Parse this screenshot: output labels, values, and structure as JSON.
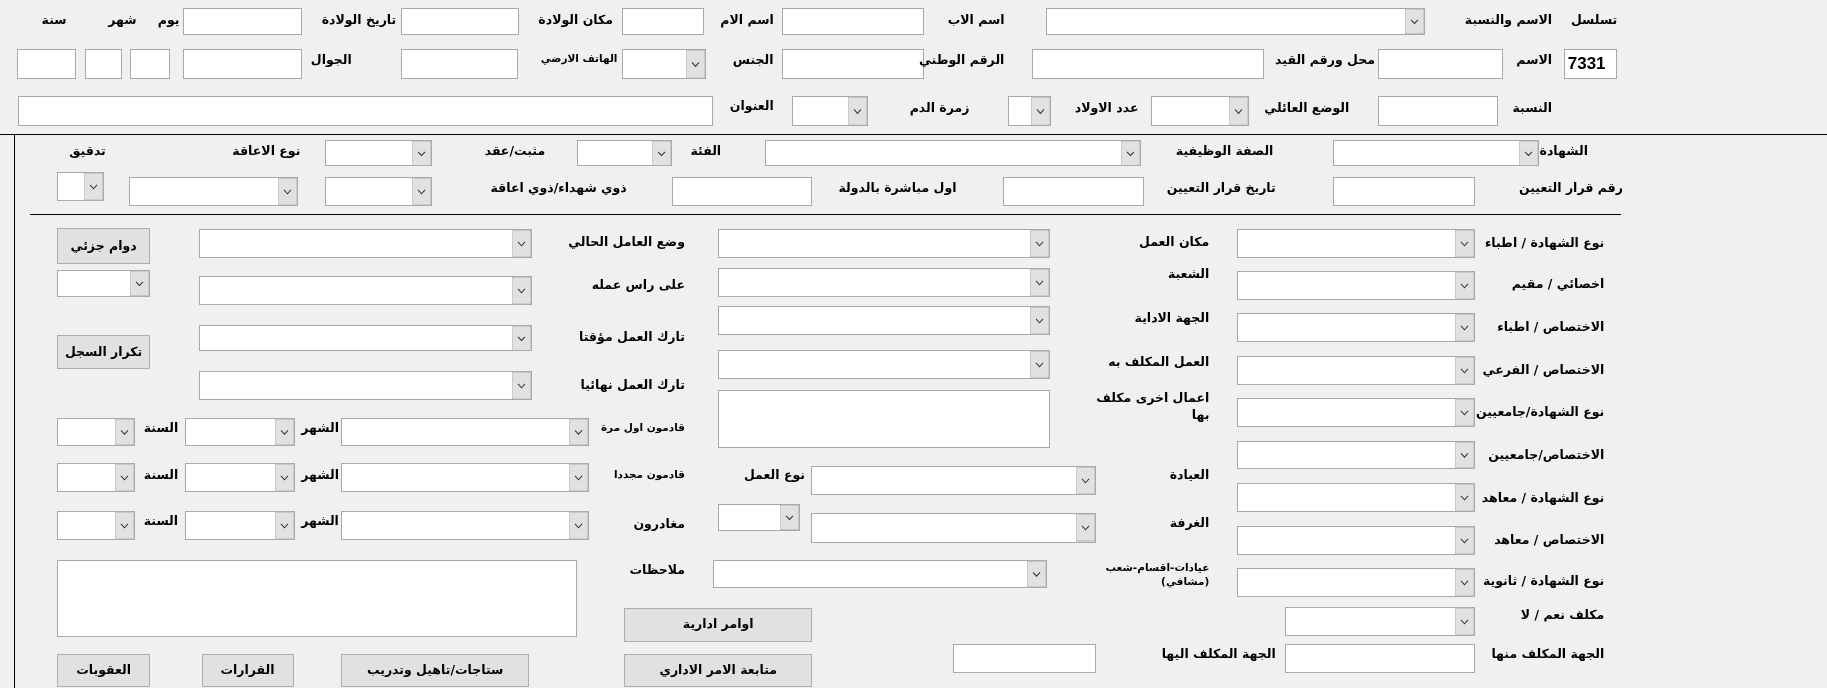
{
  "header": {
    "items": [
      {
        "kind": "label",
        "text": "تسلسل"
      },
      {
        "kind": "label",
        "text": "الاسم والنسبة"
      },
      {
        "kind": "combo"
      },
      {
        "kind": "label",
        "text": "اسم الاب"
      },
      {
        "kind": "text"
      },
      {
        "kind": "label",
        "text": "اسم الام"
      },
      {
        "kind": "text"
      },
      {
        "kind": "label",
        "text": "مكان الولادة"
      },
      {
        "kind": "text"
      },
      {
        "kind": "label",
        "text": "تاريخ الولادة"
      },
      {
        "kind": "text"
      },
      {
        "kind": "label",
        "text": "يوم"
      },
      {
        "kind": "label",
        "text": "شهر"
      },
      {
        "kind": "label",
        "text": "سنة"
      },
      {
        "kind": "text",
        "value": "7331"
      },
      {
        "kind": "label",
        "text": "الاسم"
      },
      {
        "kind": "text"
      },
      {
        "kind": "label",
        "text": "محل ورقم القيد"
      },
      {
        "kind": "text"
      },
      {
        "kind": "label",
        "text": "الرقم الوطني"
      },
      {
        "kind": "text"
      },
      {
        "kind": "label",
        "text": "الجنس"
      },
      {
        "kind": "combo"
      },
      {
        "kind": "label",
        "text": "الهاتف الارضي"
      },
      {
        "kind": "text"
      },
      {
        "kind": "label",
        "text": "الجوال"
      },
      {
        "kind": "text"
      },
      {
        "kind": "text"
      },
      {
        "kind": "text"
      },
      {
        "kind": "text"
      },
      {
        "kind": "label",
        "text": "النسبة"
      },
      {
        "kind": "text"
      },
      {
        "kind": "label",
        "text": "الوضع العائلي"
      },
      {
        "kind": "combo"
      },
      {
        "kind": "label",
        "text": "عدد الاولاد"
      },
      {
        "kind": "combo"
      },
      {
        "kind": "label",
        "text": "زمرة الدم"
      },
      {
        "kind": "combo"
      },
      {
        "kind": "label",
        "text": "العنوان"
      },
      {
        "kind": "text"
      }
    ]
  },
  "details": {
    "items": [
      {
        "kind": "label",
        "text": "الشهادة"
      },
      {
        "kind": "combo"
      },
      {
        "kind": "label",
        "text": "الصفة الوظيفية"
      },
      {
        "kind": "combo"
      },
      {
        "kind": "label",
        "text": "الفئة"
      },
      {
        "kind": "combo"
      },
      {
        "kind": "label",
        "text": "مثبت/عقد"
      },
      {
        "kind": "combo"
      },
      {
        "kind": "label",
        "text": "نوع الاعاقة"
      },
      {
        "kind": "label",
        "text": "تدقيق"
      },
      {
        "kind": "label",
        "text": "رقم قرار التعيين"
      },
      {
        "kind": "text"
      },
      {
        "kind": "label",
        "text": "تاريخ قرار التعيين"
      },
      {
        "kind": "text"
      },
      {
        "kind": "label",
        "text": "اول مباشرة بالدولة"
      },
      {
        "kind": "text"
      },
      {
        "kind": "label",
        "text": "ذوي شهداء/ذوي اعاقة"
      },
      {
        "kind": "combo"
      },
      {
        "kind": "combo"
      },
      {
        "kind": "combo"
      }
    ]
  },
  "assignment": {
    "items": [
      {
        "kind": "label",
        "text": "نوع الشهادة / اطباء"
      },
      {
        "kind": "combo"
      },
      {
        "kind": "label",
        "text": "مكان العمل"
      },
      {
        "kind": "combo"
      },
      {
        "kind": "label",
        "text": "وضع العامل الحالي"
      },
      {
        "kind": "combo"
      },
      {
        "kind": "button",
        "text": "دوام جزئي"
      },
      {
        "kind": "label",
        "text": "اخصائي / مقيم"
      },
      {
        "kind": "combo"
      },
      {
        "kind": "label",
        "text": "الشعبة"
      },
      {
        "kind": "combo"
      },
      {
        "kind": "label",
        "text": "على راس عمله"
      },
      {
        "kind": "combo"
      },
      {
        "kind": "combo"
      },
      {
        "kind": "label",
        "text": "الاختصاص / اطباء"
      },
      {
        "kind": "combo"
      },
      {
        "kind": "label",
        "text": "الجهة الاداية"
      },
      {
        "kind": "combo"
      },
      {
        "kind": "label",
        "text": "تارك العمل مؤقتا"
      },
      {
        "kind": "combo"
      },
      {
        "kind": "button",
        "text": "تكرار السجل"
      },
      {
        "kind": "label",
        "text": "الاختصاص / الفرعي"
      },
      {
        "kind": "combo"
      },
      {
        "kind": "label",
        "text": "العمل المكلف به"
      },
      {
        "kind": "combo"
      },
      {
        "kind": "label",
        "text": "تارك العمل نهائيا"
      },
      {
        "kind": "combo"
      },
      {
        "kind": "label",
        "text": "نوع الشهادة/جامعيين"
      },
      {
        "kind": "combo"
      },
      {
        "kind": "label",
        "text": "اعمال اخرى مكلف بها"
      },
      {
        "kind": "memo"
      },
      {
        "kind": "label",
        "text": "قادمون اول مرة"
      },
      {
        "kind": "combo"
      },
      {
        "kind": "label",
        "text": "الشهر"
      },
      {
        "kind": "combo"
      },
      {
        "kind": "label",
        "text": "السنة"
      },
      {
        "kind": "combo"
      },
      {
        "kind": "label",
        "text": "الاختصاص/جامعيين"
      },
      {
        "kind": "combo"
      },
      {
        "kind": "label",
        "text": "العيادة"
      },
      {
        "kind": "combo"
      },
      {
        "kind": "label",
        "text": "نوع العمل"
      },
      {
        "kind": "label",
        "text": "قادمون مجددا"
      },
      {
        "kind": "combo"
      },
      {
        "kind": "label",
        "text": "الشهر"
      },
      {
        "kind": "combo"
      },
      {
        "kind": "label",
        "text": "السنة"
      },
      {
        "kind": "combo"
      },
      {
        "kind": "label",
        "text": "نوع الشهادة / معاهد"
      },
      {
        "kind": "combo"
      },
      {
        "kind": "label",
        "text": "الغرفة"
      },
      {
        "kind": "combo"
      },
      {
        "kind": "combo"
      },
      {
        "kind": "label",
        "text": "مغادرون"
      },
      {
        "kind": "combo"
      },
      {
        "kind": "label",
        "text": "الشهر"
      },
      {
        "kind": "combo"
      },
      {
        "kind": "label",
        "text": "السنة"
      },
      {
        "kind": "combo"
      },
      {
        "kind": "label",
        "text": "الاختصاص / معاهد"
      },
      {
        "kind": "combo"
      },
      {
        "kind": "label",
        "text": "نوع الشهادة / ثانوية"
      },
      {
        "kind": "combo"
      },
      {
        "kind": "label",
        "text": "عيادات-اقسام-شعب (مشافي)"
      },
      {
        "kind": "combo"
      },
      {
        "kind": "label",
        "text": "ملاحظات"
      },
      {
        "kind": "memo"
      },
      {
        "kind": "label",
        "text": "مكلف نعم / لا"
      },
      {
        "kind": "combo"
      },
      {
        "kind": "button",
        "text": "اوامر ادارية"
      },
      {
        "kind": "label",
        "text": "الجهة المكلف منها"
      },
      {
        "kind": "text"
      },
      {
        "kind": "label",
        "text": "الجهة المكلف اليها"
      },
      {
        "kind": "text"
      },
      {
        "kind": "button",
        "text": "متابعة الامر الاداري"
      },
      {
        "kind": "button",
        "text": "ستاجات/تاهيل وتدريب"
      },
      {
        "kind": "button",
        "text": "القرارات"
      },
      {
        "kind": "button",
        "text": "العقوبات"
      }
    ]
  }
}
